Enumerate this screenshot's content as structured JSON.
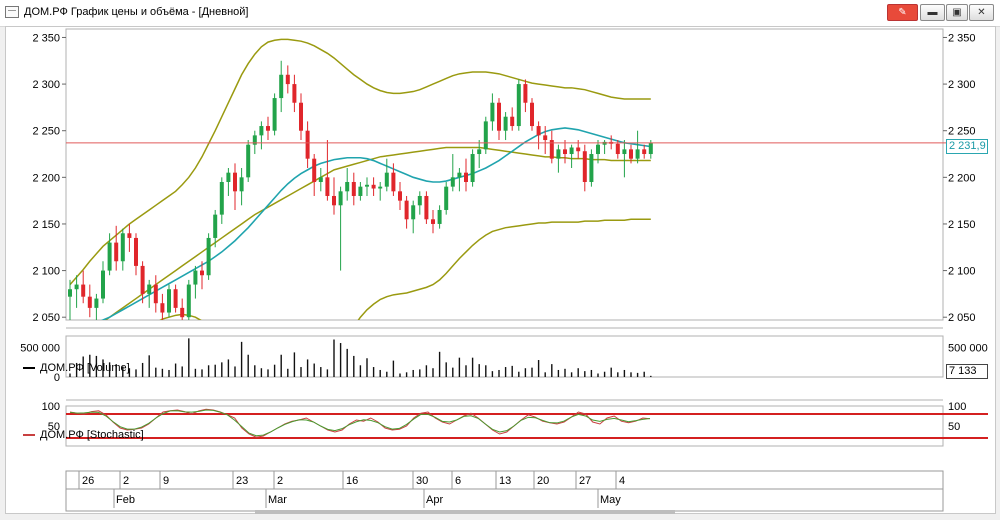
{
  "window": {
    "title": "ДОМ.РФ График цены и объёма - [Дневной]",
    "buttons": [
      "pin-icon",
      "minimize-icon",
      "restore-icon",
      "close-icon"
    ]
  },
  "price_axis": {
    "ticks": [
      "2 050",
      "2 100",
      "2 150",
      "2 200",
      "2 250",
      "2 300",
      "2 350"
    ],
    "last": "2 231,9",
    "hline": 2237,
    "min": 2047,
    "max": 2358
  },
  "volume_axis": {
    "ticks": [
      "0",
      "500 000"
    ],
    "right_ticks": [
      "500 000"
    ],
    "last": "7 133",
    "max": 700000
  },
  "stoch_axis": {
    "ticks": [
      "50",
      "100"
    ],
    "upper": 80,
    "lower": 20
  },
  "legends": {
    "volume": "ДОМ.РФ [Volume]",
    "stochastic": "ДОМ.РФ [Stochastic]"
  },
  "time_axis": {
    "days": [
      "26",
      "2",
      "9",
      "23",
      "2",
      "16",
      "30",
      "6",
      "13",
      "20",
      "27",
      "4"
    ],
    "months": [
      "Feb",
      "Mar",
      "Apr",
      "May"
    ]
  },
  "colors": {
    "up": "#22a34a",
    "down": "#e0262b",
    "ma": "#20a4ae",
    "band": "#9a9a10",
    "hline": "#e05a5a",
    "stochK": "#c84040",
    "stochD": "#4a9a30"
  },
  "chart_data": {
    "type": "candlestick",
    "candles": [
      [
        2072,
        2090,
        2045,
        2080
      ],
      [
        2080,
        2095,
        2060,
        2085
      ],
      [
        2085,
        2100,
        2065,
        2072
      ],
      [
        2072,
        2085,
        2050,
        2060
      ],
      [
        2060,
        2075,
        2045,
        2070
      ],
      [
        2070,
        2110,
        2065,
        2100
      ],
      [
        2100,
        2140,
        2095,
        2130
      ],
      [
        2130,
        2148,
        2100,
        2110
      ],
      [
        2110,
        2145,
        2100,
        2140
      ],
      [
        2140,
        2150,
        2120,
        2135
      ],
      [
        2135,
        2140,
        2095,
        2105
      ],
      [
        2105,
        2110,
        2065,
        2075
      ],
      [
        2075,
        2090,
        2060,
        2085
      ],
      [
        2085,
        2095,
        2055,
        2065
      ],
      [
        2065,
        2075,
        2045,
        2055
      ],
      [
        2055,
        2085,
        2050,
        2080
      ],
      [
        2080,
        2085,
        2055,
        2060
      ],
      [
        2060,
        2070,
        2040,
        2050
      ],
      [
        2050,
        2090,
        2045,
        2085
      ],
      [
        2085,
        2105,
        2070,
        2100
      ],
      [
        2100,
        2110,
        2080,
        2095
      ],
      [
        2095,
        2140,
        2090,
        2135
      ],
      [
        2135,
        2165,
        2125,
        2160
      ],
      [
        2160,
        2200,
        2150,
        2195
      ],
      [
        2195,
        2210,
        2180,
        2205
      ],
      [
        2205,
        2215,
        2165,
        2185
      ],
      [
        2185,
        2210,
        2170,
        2200
      ],
      [
        2200,
        2240,
        2195,
        2235
      ],
      [
        2235,
        2250,
        2225,
        2245
      ],
      [
        2245,
        2260,
        2230,
        2255
      ],
      [
        2255,
        2265,
        2240,
        2250
      ],
      [
        2250,
        2290,
        2245,
        2285
      ],
      [
        2285,
        2325,
        2270,
        2310
      ],
      [
        2310,
        2320,
        2290,
        2300
      ],
      [
        2300,
        2310,
        2270,
        2280
      ],
      [
        2280,
        2290,
        2240,
        2250
      ],
      [
        2250,
        2260,
        2210,
        2220
      ],
      [
        2220,
        2225,
        2180,
        2195
      ],
      [
        2195,
        2210,
        2185,
        2200
      ],
      [
        2200,
        2240,
        2175,
        2180
      ],
      [
        2180,
        2200,
        2160,
        2170
      ],
      [
        2170,
        2190,
        2100,
        2185
      ],
      [
        2185,
        2210,
        2175,
        2195
      ],
      [
        2195,
        2205,
        2170,
        2180
      ],
      [
        2180,
        2195,
        2175,
        2190
      ],
      [
        2190,
        2200,
        2180,
        2192
      ],
      [
        2192,
        2200,
        2180,
        2188
      ],
      [
        2188,
        2195,
        2175,
        2190
      ],
      [
        2190,
        2220,
        2185,
        2205
      ],
      [
        2205,
        2215,
        2180,
        2185
      ],
      [
        2185,
        2195,
        2165,
        2175
      ],
      [
        2175,
        2180,
        2145,
        2155
      ],
      [
        2155,
        2175,
        2140,
        2170
      ],
      [
        2170,
        2185,
        2160,
        2180
      ],
      [
        2180,
        2185,
        2150,
        2155
      ],
      [
        2155,
        2165,
        2140,
        2150
      ],
      [
        2150,
        2170,
        2145,
        2165
      ],
      [
        2165,
        2195,
        2160,
        2190
      ],
      [
        2190,
        2225,
        2185,
        2200
      ],
      [
        2200,
        2210,
        2185,
        2205
      ],
      [
        2205,
        2220,
        2185,
        2195
      ],
      [
        2195,
        2230,
        2190,
        2225
      ],
      [
        2225,
        2240,
        2210,
        2230
      ],
      [
        2230,
        2265,
        2225,
        2260
      ],
      [
        2260,
        2290,
        2250,
        2280
      ],
      [
        2280,
        2285,
        2240,
        2250
      ],
      [
        2250,
        2270,
        2240,
        2265
      ],
      [
        2265,
        2275,
        2250,
        2255
      ],
      [
        2255,
        2305,
        2250,
        2300
      ],
      [
        2300,
        2305,
        2270,
        2280
      ],
      [
        2280,
        2285,
        2250,
        2255
      ],
      [
        2255,
        2260,
        2230,
        2245
      ],
      [
        2245,
        2255,
        2225,
        2240
      ],
      [
        2240,
        2250,
        2215,
        2220
      ],
      [
        2220,
        2235,
        2205,
        2230
      ],
      [
        2230,
        2240,
        2215,
        2225
      ],
      [
        2225,
        2235,
        2210,
        2232
      ],
      [
        2232,
        2240,
        2220,
        2228
      ],
      [
        2228,
        2235,
        2185,
        2195
      ],
      [
        2195,
        2230,
        2190,
        2225
      ],
      [
        2225,
        2240,
        2215,
        2235
      ],
      [
        2235,
        2240,
        2225,
        2238
      ],
      [
        2238,
        2245,
        2230,
        2236
      ],
      [
        2236,
        2240,
        2220,
        2225
      ],
      [
        2225,
        2240,
        2200,
        2230
      ],
      [
        2230,
        2235,
        2215,
        2220
      ],
      [
        2220,
        2250,
        2215,
        2230
      ],
      [
        2230,
        2235,
        2220,
        2225
      ],
      [
        2225,
        2240,
        2220,
        2237
      ]
    ],
    "ma": [
      2030,
      2034,
      2038,
      2041,
      2044,
      2047,
      2050,
      2054,
      2058,
      2062,
      2066,
      2070,
      2074,
      2078,
      2082,
      2086,
      2090,
      2094,
      2098,
      2102,
      2106,
      2110,
      2115,
      2120,
      2126,
      2132,
      2139,
      2146,
      2154,
      2162,
      2170,
      2178,
      2186,
      2193,
      2199,
      2204,
      2208,
      2212,
      2215,
      2217,
      2219,
      2220,
      2221,
      2221,
      2221,
      2220,
      2218,
      2215,
      2212,
      2209,
      2206,
      2203,
      2200,
      2198,
      2196,
      2195,
      2195,
      2196,
      2198,
      2200,
      2202,
      2204,
      2207,
      2210,
      2214,
      2218,
      2223,
      2228,
      2233,
      2238,
      2242,
      2246,
      2249,
      2251,
      2252,
      2253,
      2252,
      2251,
      2249,
      2247,
      2245,
      2243,
      2241,
      2239,
      2237,
      2236,
      2235,
      2234,
      2233
    ],
    "upper": [
      2085,
      2093,
      2101,
      2110,
      2118,
      2126,
      2132,
      2138,
      2144,
      2150,
      2155,
      2160,
      2165,
      2170,
      2175,
      2180,
      2185,
      2192,
      2200,
      2210,
      2222,
      2236,
      2250,
      2265,
      2280,
      2295,
      2310,
      2322,
      2332,
      2340,
      2345,
      2347,
      2348,
      2348,
      2347,
      2346,
      2344,
      2341,
      2337,
      2333,
      2328,
      2322,
      2316,
      2310,
      2305,
      2300,
      2296,
      2293,
      2291,
      2290,
      2290,
      2291,
      2292,
      2294,
      2297,
      2300,
      2303,
      2306,
      2309,
      2311,
      2312,
      2313,
      2313,
      2313,
      2312,
      2311,
      2309,
      2307,
      2305,
      2303,
      2301,
      2300,
      2299,
      2298,
      2297,
      2296,
      2296,
      2295,
      2294,
      2292,
      2290,
      2288,
      2286,
      2285,
      2284,
      2284,
      2284,
      2284,
      2284
    ],
    "lower": [
      1955,
      1962,
      1970,
      1978,
      1986,
      1994,
      2002,
      2010,
      2016,
      2022,
      2028,
      2034,
      2040,
      2044,
      2048,
      2050,
      2052,
      2053,
      2052,
      2050,
      2046,
      2040,
      2034,
      2026,
      2018,
      2010,
      2002,
      1996,
      1990,
      1986,
      1984,
      1982,
      1982,
      1982,
      1984,
      1986,
      1990,
      1995,
      2000,
      2008,
      2016,
      2024,
      2032,
      2040,
      2050,
      2058,
      2064,
      2069,
      2072,
      2074,
      2075,
      2076,
      2078,
      2080,
      2082,
      2085,
      2090,
      2097,
      2105,
      2113,
      2120,
      2127,
      2133,
      2138,
      2142,
      2144,
      2146,
      2147,
      2148,
      2149,
      2150,
      2151,
      2151,
      2152,
      2152,
      2152,
      2152,
      2152,
      2153,
      2153,
      2153,
      2154,
      2154,
      2154,
      2154,
      2155,
      2155,
      2155,
      2155
    ],
    "mid": [
      2020,
      2025,
      2030,
      2035,
      2040,
      2045,
      2050,
      2055,
      2060,
      2065,
      2070,
      2075,
      2080,
      2085,
      2090,
      2095,
      2100,
      2105,
      2110,
      2115,
      2120,
      2125,
      2130,
      2135,
      2140,
      2145,
      2150,
      2155,
      2160,
      2164,
      2168,
      2172,
      2176,
      2180,
      2184,
      2188,
      2192,
      2196,
      2200,
      2204,
      2208,
      2210,
      2212,
      2214,
      2216,
      2218,
      2220,
      2222,
      2223,
      2224,
      2225,
      2226,
      2227,
      2228,
      2229,
      2230,
      2231,
      2232,
      2232,
      2232,
      2232,
      2232,
      2232,
      2231,
      2230,
      2229,
      2228,
      2227,
      2226,
      2225,
      2224,
      2223,
      2222,
      2222,
      2221,
      2221,
      2220,
      2220,
      2220,
      2219,
      2219,
      2219,
      2218,
      2218,
      2218,
      2218,
      2218,
      2218,
      2218
    ],
    "volume": [
      60000,
      240000,
      350000,
      380000,
      360000,
      300000,
      250000,
      220000,
      180000,
      150000,
      130000,
      240000,
      370000,
      160000,
      140000,
      120000,
      230000,
      180000,
      660000,
      140000,
      130000,
      200000,
      210000,
      250000,
      300000,
      180000,
      600000,
      380000,
      200000,
      150000,
      130000,
      210000,
      380000,
      140000,
      420000,
      170000,
      300000,
      230000,
      170000,
      130000,
      640000,
      580000,
      480000,
      360000,
      200000,
      320000,
      170000,
      120000,
      90000,
      280000,
      60000,
      80000,
      120000,
      130000,
      200000,
      150000,
      430000,
      250000,
      160000,
      330000,
      200000,
      330000,
      220000,
      200000,
      100000,
      120000,
      170000,
      190000,
      90000,
      150000,
      160000,
      290000,
      80000,
      220000,
      120000,
      140000,
      80000,
      150000,
      100000,
      120000,
      60000,
      90000,
      160000,
      80000,
      120000,
      80000,
      70000,
      90000,
      20000
    ],
    "stochK": [
      85,
      82,
      80,
      86,
      88,
      78,
      60,
      45,
      40,
      42,
      45,
      55,
      70,
      85,
      88,
      90,
      86,
      80,
      88,
      92,
      90,
      85,
      78,
      70,
      45,
      30,
      22,
      25,
      35,
      45,
      55,
      62,
      65,
      70,
      60,
      50,
      40,
      35,
      40,
      55,
      65,
      62,
      70,
      60,
      45,
      40,
      42,
      50,
      70,
      82,
      85,
      70,
      60,
      55,
      65,
      75,
      82,
      70,
      55,
      40,
      30,
      35,
      50,
      65,
      78,
      72,
      62,
      58,
      55,
      60,
      72,
      85,
      80,
      60,
      55,
      70,
      75,
      62,
      58,
      62,
      70,
      68
    ]
  }
}
